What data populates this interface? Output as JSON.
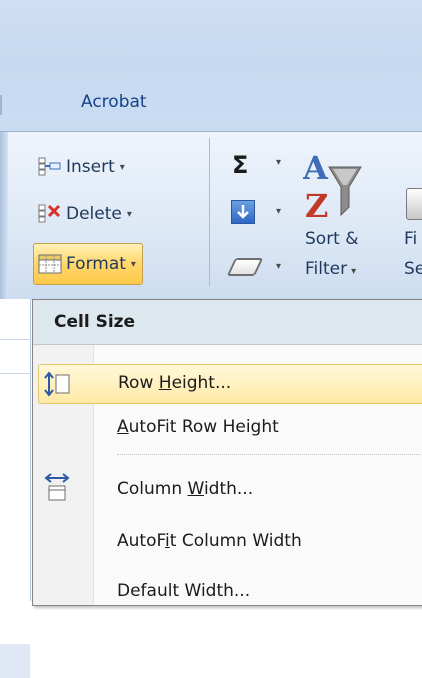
{
  "ribbon": {
    "tab": "Acrobat",
    "cells_group": {
      "insert_label": "Insert",
      "delete_label": "Delete",
      "format_label": "Format"
    },
    "editing_group": {
      "autosum_icon": "sigma-icon",
      "sort_label_line1": "Sort &",
      "sort_label_line2": "Filter",
      "find_label_line1": "Fi",
      "find_label_line2": "Se"
    },
    "dropdown_glyph": "▾"
  },
  "format_menu": {
    "section_header": "Cell Size",
    "items": [
      {
        "label_pre": "Row ",
        "label_access": "H",
        "label_post": "eight...",
        "icon": "row-height-icon",
        "highlighted": true
      },
      {
        "label_pre": "",
        "label_access": "A",
        "label_post": "utoFit Row Height",
        "icon": "",
        "highlighted": false
      },
      {
        "label_pre": "Column ",
        "label_access": "W",
        "label_post": "idth...",
        "icon": "column-width-icon",
        "highlighted": false
      },
      {
        "label_pre": "AutoF",
        "label_access": "i",
        "label_post": "t Column Width",
        "icon": "",
        "highlighted": false
      },
      {
        "label_pre": "Default Width...",
        "label_access": "",
        "label_post": "",
        "icon": "",
        "highlighted": false
      }
    ]
  },
  "colors": {
    "ribbon_blue": "#c6d9f0",
    "hover_gold": "#ffd66b",
    "menu_header": "#dde7ee"
  }
}
